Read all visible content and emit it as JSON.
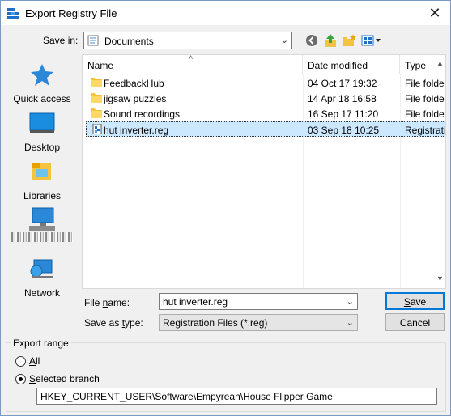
{
  "window": {
    "title": "Export Registry File",
    "close_glyph": "✕"
  },
  "save_in": {
    "label": "Save in:",
    "value": "Documents"
  },
  "toolbar": {
    "icons": [
      "back-icon",
      "up-folder-icon",
      "new-folder-icon",
      "view-menu-icon"
    ]
  },
  "places": [
    {
      "label": "Quick access",
      "icon": "star-icon"
    },
    {
      "label": "Desktop",
      "icon": "desktop-icon"
    },
    {
      "label": "Libraries",
      "icon": "libraries-icon"
    },
    {
      "label": "",
      "icon": "this-pc-icon"
    },
    {
      "label": "Network",
      "icon": "network-icon"
    }
  ],
  "columns": {
    "name": "Name",
    "date": "Date modified",
    "type": "Type"
  },
  "files": [
    {
      "name": "FeedbackHub",
      "date": "04 Oct 17 19:32",
      "type": "File folder",
      "icon": "folder-icon"
    },
    {
      "name": "jigsaw puzzles",
      "date": "14 Apr 18 16:58",
      "type": "File folder",
      "icon": "folder-icon"
    },
    {
      "name": "Sound recordings",
      "date": "16 Sep 17 11:20",
      "type": "File folder",
      "icon": "folder-icon"
    },
    {
      "name": "hut inverter.reg",
      "date": "03 Sep 18 10:25",
      "type": "Registration",
      "icon": "reg-file-icon",
      "selected": true
    }
  ],
  "file_name": {
    "label_pre": "File ",
    "label_u": "n",
    "label_post": "ame:",
    "value": "hut inverter.reg"
  },
  "save_type": {
    "label_pre": "Save as ",
    "label_u": "t",
    "label_post": "ype:",
    "value": "Registration Files (*.reg)"
  },
  "buttons": {
    "save_u": "S",
    "save_rest": "ave",
    "cancel": "Cancel"
  },
  "export_range": {
    "title": "Export range",
    "all_u": "A",
    "all_rest": "ll",
    "selected_u": "S",
    "selected_rest": "elected branch",
    "branch_value": "HKEY_CURRENT_USER\\Software\\Empyrean\\House Flipper Game"
  }
}
